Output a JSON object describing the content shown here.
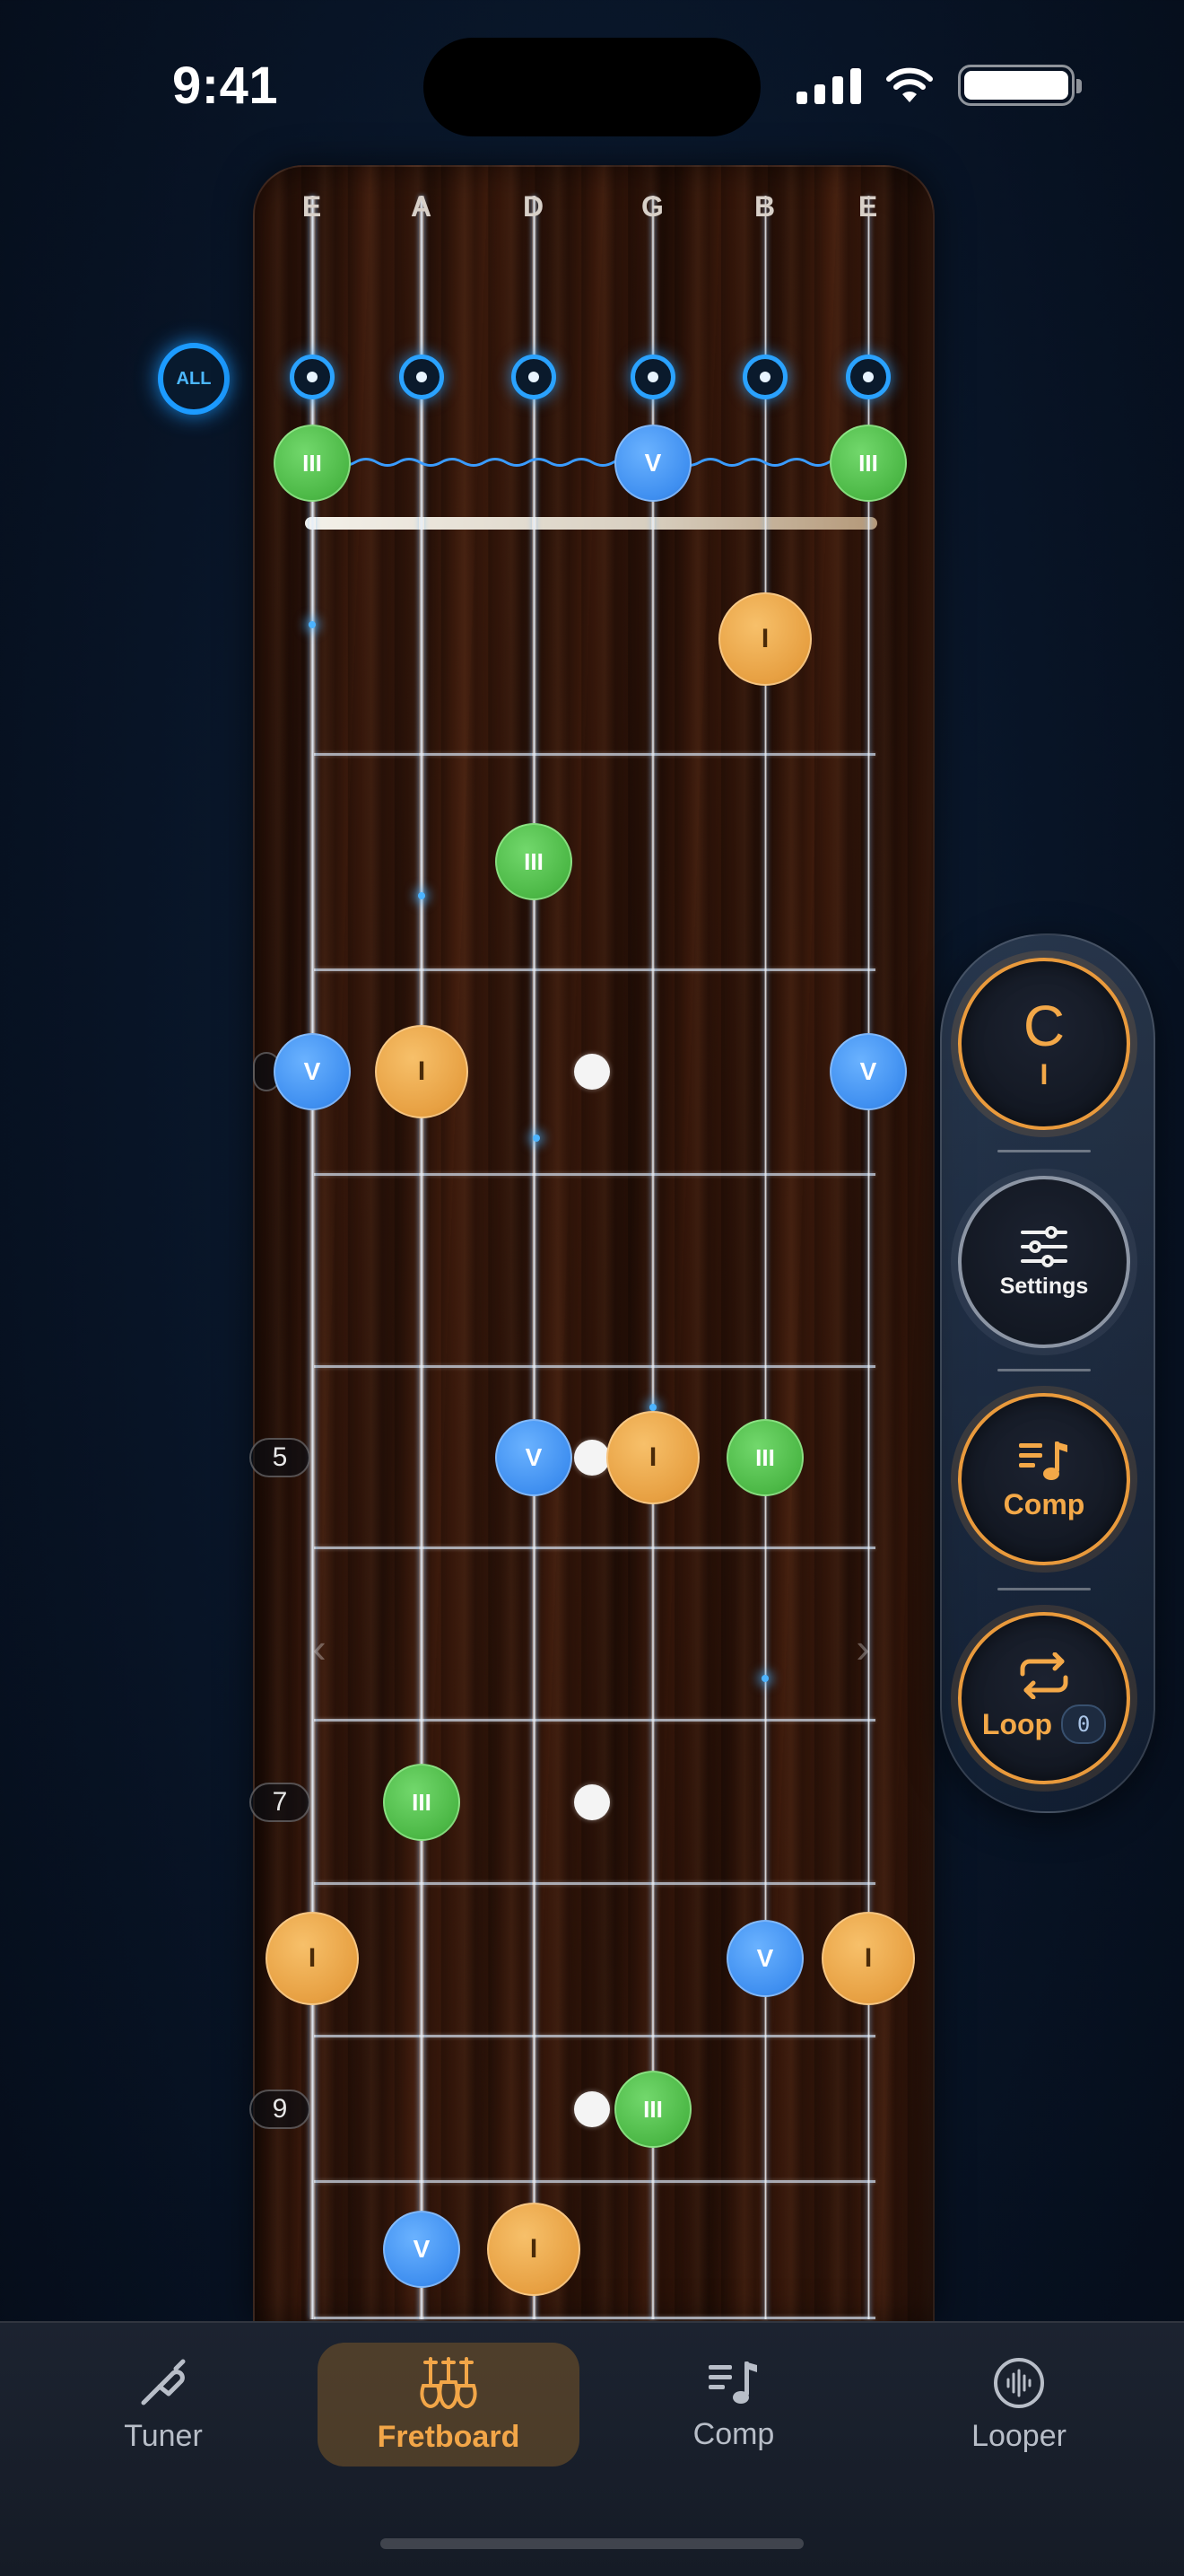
{
  "status_bar": {
    "time": "9:41"
  },
  "fretboard": {
    "strings": [
      "E",
      "A",
      "D",
      "G",
      "B",
      "E"
    ],
    "all_toggle_label": "ALL",
    "fret_numbers": [
      "5",
      "7",
      "9"
    ],
    "notes": [
      {
        "degree": "III",
        "type": "third"
      },
      {
        "degree": "V",
        "type": "fifth"
      },
      {
        "degree": "III",
        "type": "third"
      },
      {
        "degree": "I",
        "type": "root"
      },
      {
        "degree": "III",
        "type": "third"
      },
      {
        "degree": "V",
        "type": "fifth"
      },
      {
        "degree": "I",
        "type": "root"
      },
      {
        "degree": "V",
        "type": "fifth"
      },
      {
        "degree": "V",
        "type": "fifth"
      },
      {
        "degree": "I",
        "type": "root"
      },
      {
        "degree": "III",
        "type": "third"
      },
      {
        "degree": "III",
        "type": "third"
      },
      {
        "degree": "I",
        "type": "root"
      },
      {
        "degree": "V",
        "type": "fifth"
      },
      {
        "degree": "I",
        "type": "root"
      },
      {
        "degree": "III",
        "type": "third"
      },
      {
        "degree": "V",
        "type": "fifth"
      },
      {
        "degree": "I",
        "type": "root"
      }
    ]
  },
  "side_panel": {
    "key": {
      "letter": "C",
      "degree": "I"
    },
    "settings_label": "Settings",
    "comp_label": "Comp",
    "loop_label": "Loop",
    "loop_count": "0"
  },
  "tabs": [
    {
      "label": "Tuner",
      "icon": "tuning-fork-icon"
    },
    {
      "label": "Fretboard",
      "icon": "guitars-icon",
      "active": true
    },
    {
      "label": "Comp",
      "icon": "music-list-icon"
    },
    {
      "label": "Looper",
      "icon": "waveform-icon"
    }
  ],
  "colors": {
    "root": "#e7a042",
    "third": "#4cb846",
    "fifth": "#3f8ff0",
    "accent": "#f2a648",
    "toggle": "#2aa2ff"
  }
}
